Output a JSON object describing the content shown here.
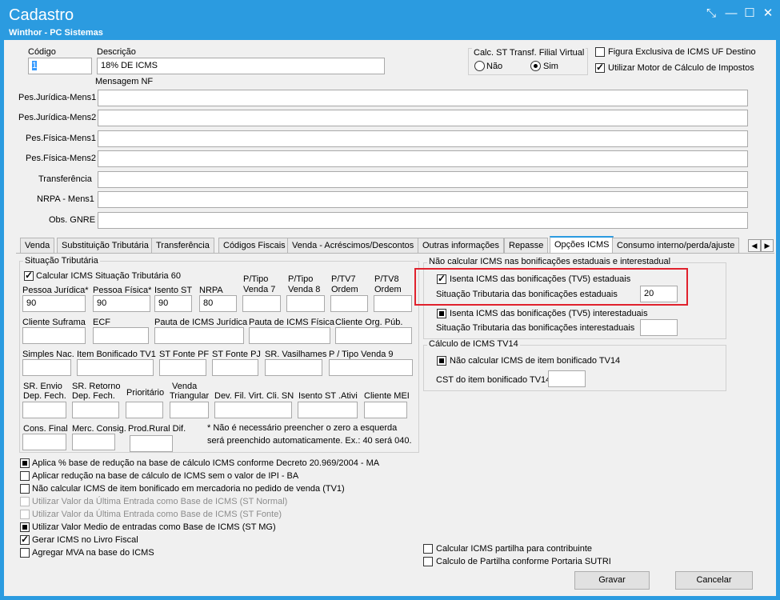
{
  "window": {
    "title": "Cadastro",
    "subtitle": "Winthor - PC Sistemas"
  },
  "header": {
    "codigo_label": "Código",
    "codigo_value": "1",
    "descricao_label": "Descrição",
    "descricao_value": "18% DE ICMS",
    "calc_st_label": "Calc. ST Transf. Filial Virtual",
    "radio_nao": "Não",
    "radio_sim": "Sim",
    "figura_exclusiva": "Figura Exclusiva de ICMS UF Destino",
    "utilizar_motor": "Utilizar Motor de Cálculo de Impostos",
    "mensagem_nf": "Mensagem NF"
  },
  "mensagens": [
    {
      "label": "Pes.Jurídica-Mens1",
      "value": ""
    },
    {
      "label": "Pes.Jurídica-Mens2",
      "value": ""
    },
    {
      "label": "Pes.Física-Mens1",
      "value": ""
    },
    {
      "label": "Pes.Física-Mens2",
      "value": ""
    },
    {
      "label": "Transferência",
      "value": ""
    },
    {
      "label": "NRPA - Mens1",
      "value": ""
    },
    {
      "label": "Obs. GNRE",
      "value": ""
    }
  ],
  "tabs": [
    "Venda",
    "Substituição Tributária",
    "Transferência",
    "Códigos Fiscais",
    "Venda - Acréscimos/Descontos",
    "Outras informações",
    "Repasse",
    "Opções ICMS",
    "Consumo interno/perda/ajuste"
  ],
  "situacao": {
    "group_label": "Situação Tributária",
    "calcular_60": "Calcular ICMS Situação Tributária 60",
    "pessoa_juridica": "Pessoa Jurídica*",
    "pessoa_juridica_value": "90",
    "pessoa_fisica": "Pessoa Física*",
    "pessoa_fisica_value": "90",
    "isento_st": "Isento ST",
    "isento_st_value": "90",
    "nrpa": "NRPA",
    "nrpa_value": "80",
    "p_tipo_venda7_a": "P/Tipo",
    "p_tipo_venda7_b": "Venda 7",
    "p_tipo_venda8_a": "P/Tipo",
    "p_tipo_venda8_b": "Venda 8",
    "p_tv7_a": "P/TV7",
    "p_tv7_b": "Ordem",
    "p_tv8_a": "P/TV8",
    "p_tv8_b": "Ordem",
    "cliente_suframa": "Cliente Suframa",
    "ecf": "ECF",
    "pauta_juridica": "Pauta de ICMS Jurídica",
    "pauta_fisica": "Pauta de ICMS Física",
    "cliente_org_pub": "Cliente Org. Púb.",
    "simples_nac": "Simples Nac.",
    "item_bonificado": "Item Bonificado TV1",
    "st_fonte_pf": "ST Fonte PF",
    "st_fonte_pj": "ST Fonte PJ",
    "sr_vasilhames": "SR. Vasilhames",
    "p_tipo_venda9": "P / Tipo Venda 9",
    "sr_envio_a": "SR. Envio",
    "sr_envio_b": "Dep. Fech.",
    "sr_retorno_a": "SR. Retorno",
    "sr_retorno_b": "Dep. Fech.",
    "prioritario": "Prioritário",
    "venda_tri_a": "Venda",
    "venda_tri_b": "Triangular",
    "dev_fil": "Dev. Fil. Virt. Cli. SN",
    "isento_st_ativi": "Isento ST .Ativi",
    "cliente_mei": "Cliente MEI",
    "cons_final": "Cons. Final",
    "merc_consig": "Merc. Consig.",
    "prod_rural": "Prod.Rural Dif.",
    "note1": "* Não é necessário preencher o zero a esquerda",
    "note2": "será preenchido automaticamente.  Ex.: 40 será 040."
  },
  "bonificacoes": {
    "group_label": "Não calcular ICMS nas bonificações estaduais e interestadual",
    "isenta_estaduais": "Isenta ICMS das bonificações (TV5) estaduais",
    "sit_estaduais": "Situação Tributaria das  bonificações estaduais",
    "sit_estaduais_value": "20",
    "isenta_interestaduais": "Isenta ICMS das bonificações (TV5) interestaduais",
    "sit_interestaduais": "Situação Tributaria das  bonificações interestaduais",
    "sit_interestaduais_value": ""
  },
  "tv14": {
    "group_label": "Cálculo de ICMS TV14",
    "nao_calcular": "Não calcular ICMS de item bonificado TV14",
    "cst_label": "CST do item bonificado TV14",
    "cst_value": ""
  },
  "options": [
    {
      "label": "Aplica % base de redução na base de cálculo ICMS conforme Decreto 20.969/2004 - MA",
      "state": "filled",
      "disabled": false
    },
    {
      "label": "Aplicar redução na base de cálculo de ICMS sem o valor de IPI - BA",
      "state": "empty",
      "disabled": false
    },
    {
      "label": "Não calcular ICMS de item bonificado em mercadoria no pedido de venda (TV1)",
      "state": "empty",
      "disabled": false
    },
    {
      "label": "Utilizar Valor da Última Entrada como Base de ICMS (ST Normal)",
      "state": "empty",
      "disabled": true
    },
    {
      "label": "Utilizar Valor da Última Entrada como Base de ICMS (ST Fonte)",
      "state": "empty",
      "disabled": true
    },
    {
      "label": "Utilizar Valor Medio de entradas como Base de ICMS (ST MG)",
      "state": "filled",
      "disabled": false
    },
    {
      "label": "Gerar ICMS no Livro Fiscal",
      "state": "checked",
      "disabled": false
    },
    {
      "label": "Agregar MVA na base do ICMS",
      "state": "empty",
      "disabled": false
    }
  ],
  "partilha": {
    "contribuinte": "Calcular ICMS partilha para contribuinte",
    "sutri": "Calculo de Partilha conforme Portaria SUTRI"
  },
  "buttons": {
    "gravar": "Gravar",
    "cancelar": "Cancelar"
  }
}
